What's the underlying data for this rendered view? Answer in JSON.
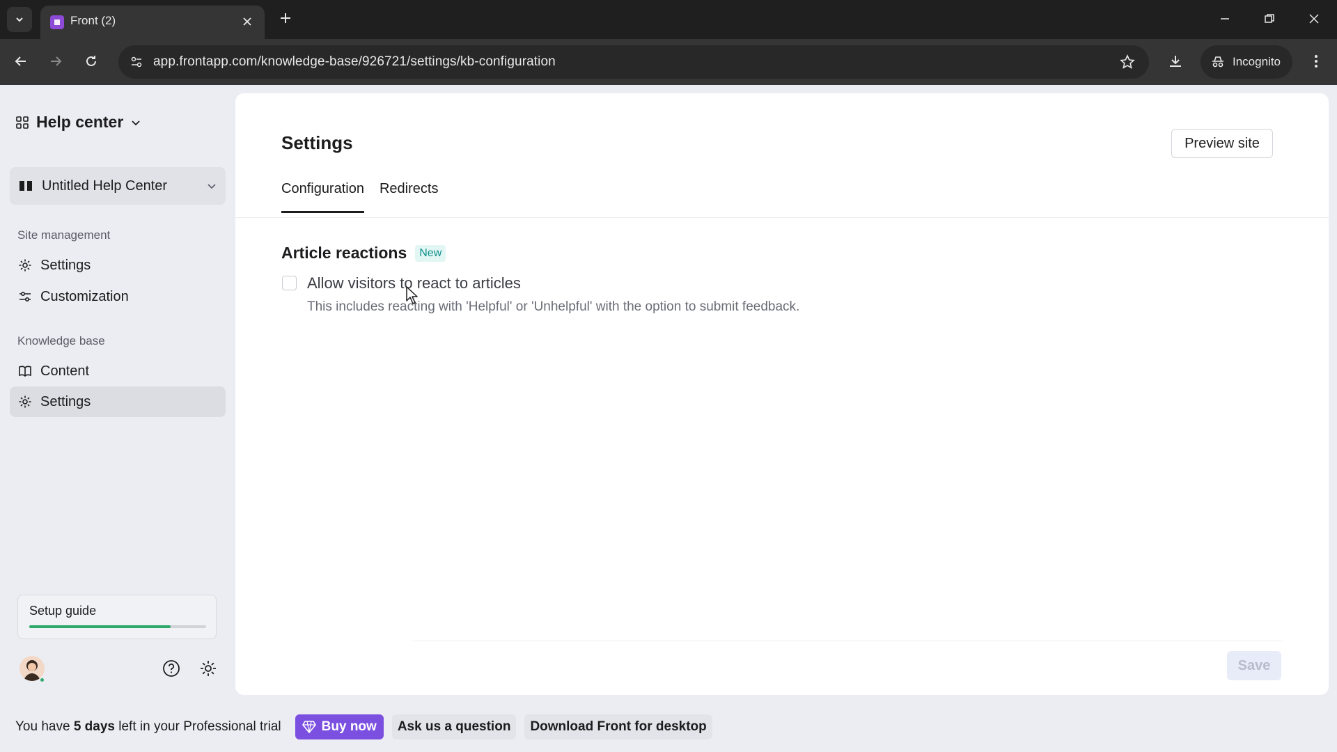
{
  "browser": {
    "tab_title": "Front (2)",
    "url": "app.frontapp.com/knowledge-base/926721/settings/kb-configuration",
    "incognito_label": "Incognito",
    "accent_color": "#8d4ad6"
  },
  "sidebar": {
    "header_title": "Help center",
    "kb_selector": "Untitled Help Center",
    "site_management_label": "Site management",
    "site_management_items": [
      {
        "label": "Settings",
        "icon": "gear-icon"
      },
      {
        "label": "Customization",
        "icon": "sliders-icon"
      }
    ],
    "knowledge_base_label": "Knowledge base",
    "knowledge_base_items": [
      {
        "label": "Content",
        "icon": "book-icon"
      },
      {
        "label": "Settings",
        "icon": "gear-icon",
        "active": true
      }
    ],
    "setup_guide": {
      "label": "Setup guide",
      "progress": 0.8
    }
  },
  "main": {
    "title": "Settings",
    "preview_button": "Preview site",
    "tabs": [
      {
        "label": "Configuration",
        "active": true
      },
      {
        "label": "Redirects",
        "active": false
      }
    ],
    "section": {
      "title": "Article reactions",
      "badge": "New",
      "checkbox_label": "Allow visitors to react to articles",
      "checkbox_checked": false,
      "checkbox_help": "This includes reacting with 'Helpful' or 'Unhelpful' with the option to submit feedback."
    },
    "save_button": "Save"
  },
  "trial_bar": {
    "text_prefix": "You have ",
    "days": "5 days",
    "text_suffix": " left in your Professional trial",
    "buy_button": "Buy now",
    "ask_button": "Ask us a question",
    "download_button": "Download Front for desktop"
  }
}
